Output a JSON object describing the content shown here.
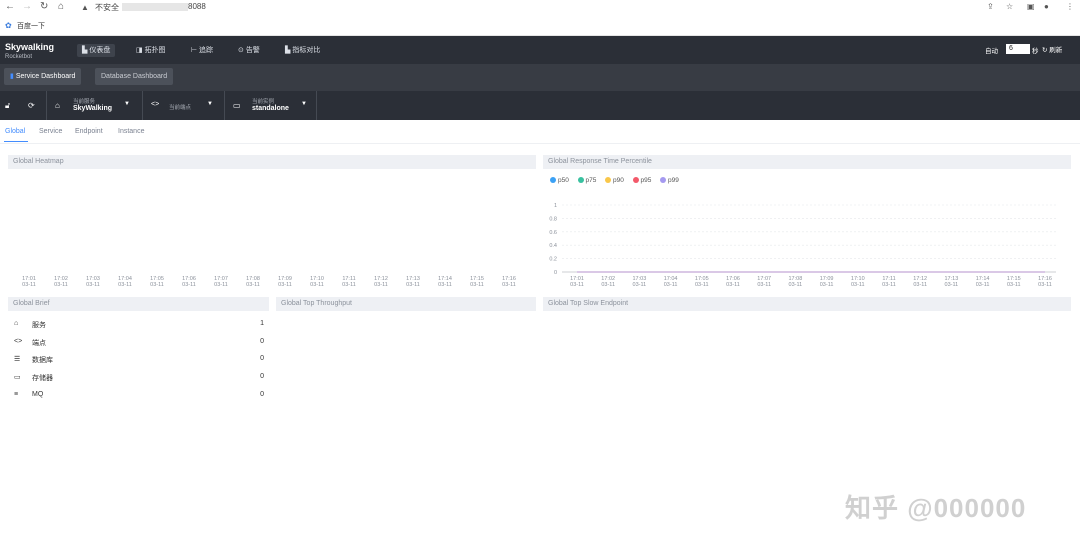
{
  "browser": {
    "insecure_label": "不安全",
    "url_port": "8088",
    "bookmark": "百度一下"
  },
  "header": {
    "logo": "Skywalking",
    "logo_sub": "Rocketbot",
    "nav": [
      "仪表盘",
      "拓扑图",
      "追踪",
      "告警",
      "指标对比"
    ],
    "auto_label": "自动",
    "auto_seconds": "6",
    "sec_label": "秒",
    "refresh_label": "刷新"
  },
  "dashboards": {
    "service": "Service Dashboard",
    "database": "Database Dashboard"
  },
  "selectors": {
    "service_label": "当前服务",
    "service_value": "SkyWalking",
    "endpoint_label": "当前端点",
    "instance_label": "当前实例",
    "instance_value": "standalone"
  },
  "subtabs": [
    "Global",
    "Service",
    "Endpoint",
    "Instance"
  ],
  "panels": {
    "heatmap": "Global Heatmap",
    "percentile": "Global Response Time Percentile",
    "brief": "Global Brief",
    "throughput": "Global Top Throughput",
    "slow": "Global Top Slow Endpoint"
  },
  "time_ticks": [
    "17:01",
    "17:02",
    "17:03",
    "17:04",
    "17:05",
    "17:06",
    "17:07",
    "17:08",
    "17:09",
    "17:10",
    "17:11",
    "17:12",
    "17:13",
    "17:14",
    "17:15",
    "17:16"
  ],
  "tick_date": "03-11",
  "chart_data": {
    "type": "line",
    "title": "Global Response Time Percentile",
    "x": [
      "17:01",
      "17:02",
      "17:03",
      "17:04",
      "17:05",
      "17:06",
      "17:07",
      "17:08",
      "17:09",
      "17:10",
      "17:11",
      "17:12",
      "17:13",
      "17:14",
      "17:15",
      "17:16"
    ],
    "y_ticks": [
      "1",
      "0.8",
      "0.6",
      "0.4",
      "0.2",
      "0"
    ],
    "ylim": [
      0,
      1
    ],
    "series": [
      {
        "name": "p50",
        "color": "#3ba1f5",
        "values": [
          0,
          0,
          0,
          0,
          0,
          0,
          0,
          0,
          0,
          0,
          0,
          0,
          0,
          0,
          0,
          0
        ]
      },
      {
        "name": "p75",
        "color": "#39c1a0",
        "values": [
          0,
          0,
          0,
          0,
          0,
          0,
          0,
          0,
          0,
          0,
          0,
          0,
          0,
          0,
          0,
          0
        ]
      },
      {
        "name": "p90",
        "color": "#f9c74a",
        "values": [
          0,
          0,
          0,
          0,
          0,
          0,
          0,
          0,
          0,
          0,
          0,
          0,
          0,
          0,
          0,
          0
        ]
      },
      {
        "name": "p95",
        "color": "#f3596a",
        "values": [
          0,
          0,
          0,
          0,
          0,
          0,
          0,
          0,
          0,
          0,
          0,
          0,
          0,
          0,
          0,
          0
        ]
      },
      {
        "name": "p99",
        "color": "#a59af0",
        "values": [
          0,
          0,
          0,
          0,
          0,
          0,
          0,
          0,
          0,
          0,
          0,
          0,
          0,
          0,
          0,
          0
        ]
      }
    ],
    "legend": "top-left"
  },
  "brief": [
    {
      "icon": "service-icon",
      "label": "服务",
      "value": "1"
    },
    {
      "icon": "endpoint-icon",
      "label": "端点",
      "value": "0"
    },
    {
      "icon": "database-icon",
      "label": "数据库",
      "value": "0"
    },
    {
      "icon": "storage-icon",
      "label": "存储器",
      "value": "0"
    },
    {
      "icon": "mq-icon",
      "label": "MQ",
      "value": "0"
    }
  ],
  "watermark": "知乎 @000000"
}
